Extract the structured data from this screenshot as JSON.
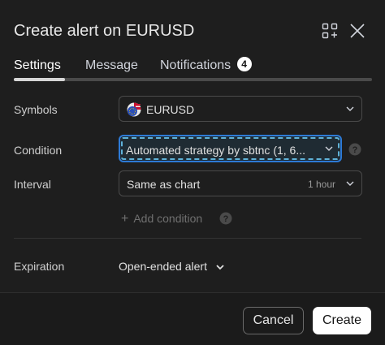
{
  "dialog": {
    "title": "Create alert on EURUSD"
  },
  "tabs": [
    {
      "label": "Settings",
      "active": true
    },
    {
      "label": "Message",
      "active": false
    },
    {
      "label": "Notifications",
      "active": false,
      "badge": "4"
    }
  ],
  "form": {
    "symbols": {
      "label": "Symbols",
      "value": "EURUSD",
      "icon": "eu-us-flag-icon"
    },
    "condition": {
      "label": "Condition",
      "value": "Automated strategy by sbtnc (1, 6..."
    },
    "interval": {
      "label": "Interval",
      "value": "Same as chart",
      "hint": "1 hour"
    },
    "add_condition": "Add condition",
    "expiration": {
      "label": "Expiration",
      "value": "Open-ended alert"
    }
  },
  "footer": {
    "cancel_label": "Cancel",
    "create_label": "Create"
  },
  "colors": {
    "background": "#1e1e1e",
    "focus_ring": "#2d7ad6",
    "primary_button": "#ffffff"
  }
}
